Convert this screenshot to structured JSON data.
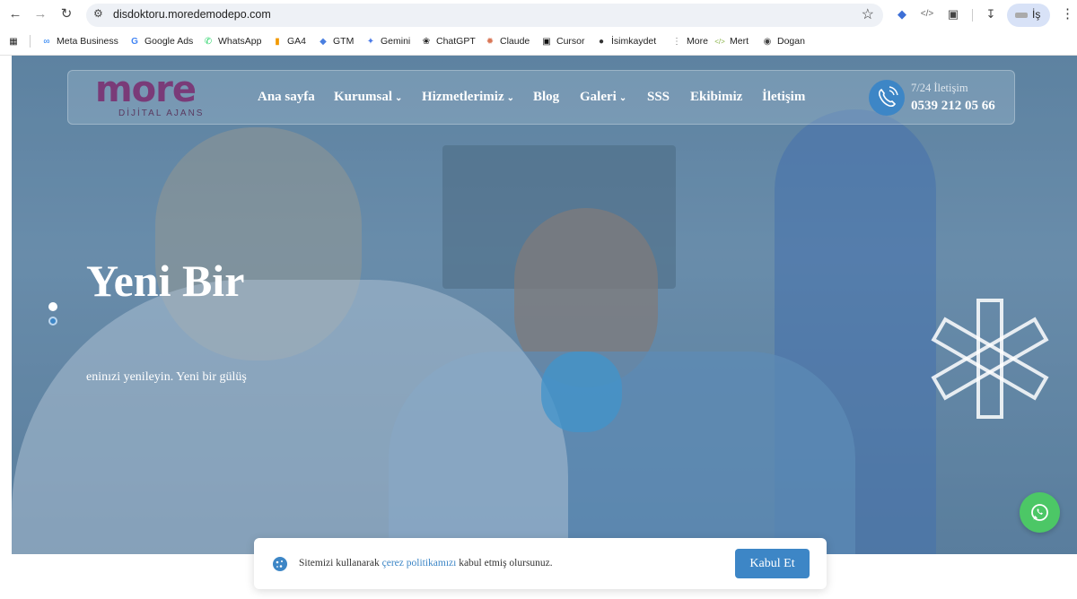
{
  "browser": {
    "url": "disdoktoru.moredemodepo.com",
    "profile_label": "İş",
    "bookmarks": [
      {
        "label": "Meta Business",
        "icon": "meta-icon"
      },
      {
        "label": "Google Ads",
        "icon": "google-icon"
      },
      {
        "label": "WhatsApp",
        "icon": "whatsapp-icon"
      },
      {
        "label": "GA4",
        "icon": "analytics-icon"
      },
      {
        "label": "GTM",
        "icon": "gtm-icon"
      },
      {
        "label": "Gemini",
        "icon": "gemini-icon"
      },
      {
        "label": "ChatGPT",
        "icon": "chatgpt-icon"
      },
      {
        "label": "Claude",
        "icon": "claude-icon"
      },
      {
        "label": "Cursor",
        "icon": "cursor-icon"
      },
      {
        "label": "İsimkaydet",
        "icon": "isimkaydet-icon"
      },
      {
        "label": "More",
        "icon": "more-icon"
      },
      {
        "label": "Mert",
        "icon": "code-icon"
      },
      {
        "label": "Dogan",
        "icon": "globe-icon"
      }
    ]
  },
  "site": {
    "logo_text": "more",
    "logo_subtitle": "DİJİTAL AJANS",
    "menu": [
      {
        "label": "Ana sayfa",
        "has_dropdown": false
      },
      {
        "label": "Kurumsal",
        "has_dropdown": true
      },
      {
        "label": "Hizmetlerimiz",
        "has_dropdown": true
      },
      {
        "label": "Blog",
        "has_dropdown": false
      },
      {
        "label": "Galeri",
        "has_dropdown": true
      },
      {
        "label": "SSS",
        "has_dropdown": false
      },
      {
        "label": "Ekibimiz",
        "has_dropdown": false
      },
      {
        "label": "İletişim",
        "has_dropdown": false
      }
    ],
    "contact": {
      "label": "7/24 İletişim",
      "phone": "0539 212 05 66"
    },
    "hero": {
      "title": "Yeni Bir",
      "subtitle": "eninızi yenileyin. Yeni bir gülüş"
    },
    "cookie": {
      "text_before": "Sitemizi kullanarak ",
      "link_text": "çerez politikamızı",
      "text_after": " kabul etmiş olursunuz.",
      "button": "Kabul Et"
    },
    "colors": {
      "accent": "#3d86c6",
      "whatsapp": "#4cc766",
      "logo": "#7a3b78"
    }
  }
}
